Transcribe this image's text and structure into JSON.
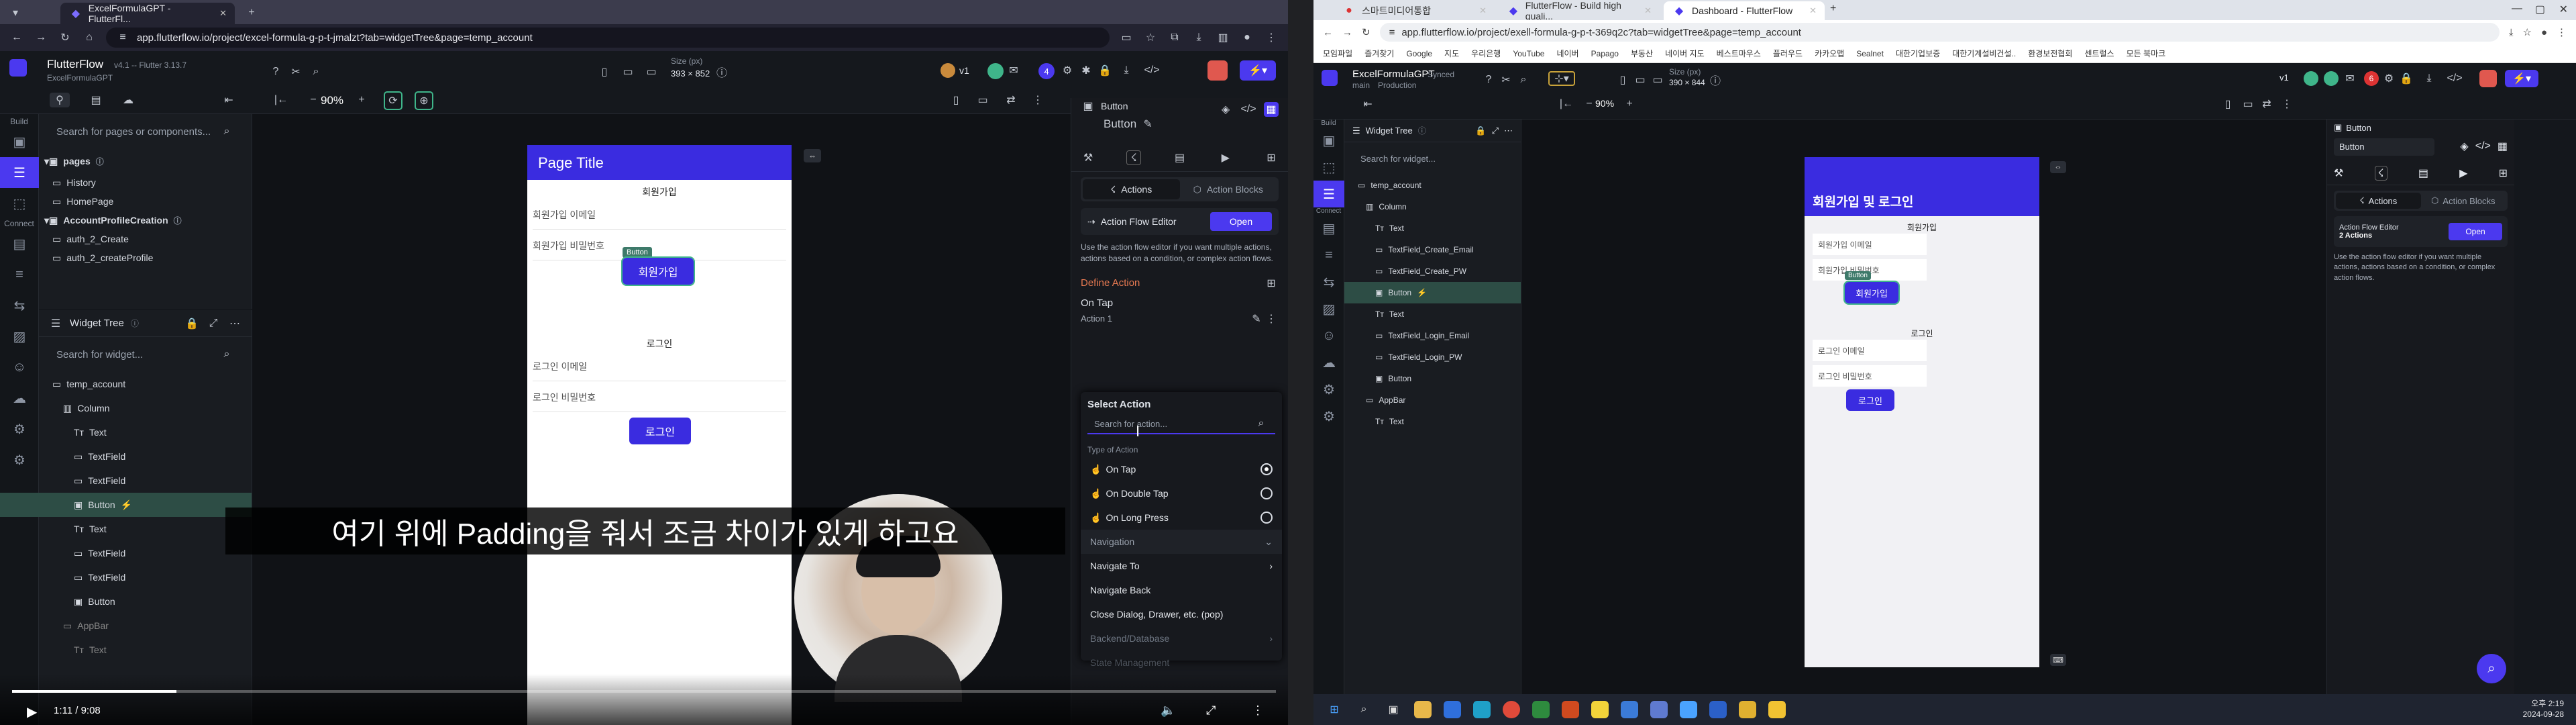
{
  "left": {
    "tabs": [
      {
        "label": "ExcelFormulaGPT - FlutterFl..."
      }
    ],
    "url": "app.flutterflow.io/project/excel-formula-g-p-t-jmalzt?tab=widgetTree&page=temp_account",
    "project": {
      "name": "FlutterFlow",
      "version": "v4.1 -- Flutter 3.13.7",
      "sub": "ExcelFormulaGPT"
    },
    "zoom": "90%",
    "size": {
      "label": "Size (px)",
      "value": "393 × 852"
    },
    "version_badge": "v1",
    "count_badge": "4",
    "rail": {
      "build": "Build",
      "connect": "Connect"
    },
    "pages": {
      "search": "Search for pages or components...",
      "header": "pages",
      "items": [
        "History",
        "HomePage"
      ],
      "folder": "AccountProfileCreation",
      "sub_items": [
        "auth_2_Create",
        "auth_2_createProfile"
      ]
    },
    "widget_tree": {
      "title": "Widget Tree",
      "search": "Search for widget...",
      "root": "temp_account",
      "items": [
        "Column",
        "Text",
        "TextField",
        "TextField",
        "Button",
        "Text",
        "TextField",
        "TextField",
        "Button",
        "AppBar",
        "Text"
      ]
    },
    "canvas": {
      "appbar_title": "Page Title",
      "signup_heading": "회원가입",
      "signup_email": "회원가입 이메일",
      "signup_password": "회원가입 비밀번호",
      "button_tag": "Button",
      "signup_button": "회원가입",
      "login_heading": "로그인",
      "login_email": "로그인 이메일",
      "login_password": "로그인 비밀번호",
      "login_button": "로그인"
    },
    "props": {
      "title": "Button",
      "subtitle": "Button",
      "tabs": [
        "Actions",
        "Action Blocks"
      ],
      "flow_editor": "Action Flow Editor",
      "open": "Open",
      "flow_desc": "Use the action flow editor if you want multiple actions, actions based on a condition, or complex action flows.",
      "define": "Define Action",
      "on_tap": "On Tap",
      "action1": "Action 1",
      "select_action": "Select Action",
      "search_action": "Search for action...",
      "type_label": "Type of Action",
      "types": [
        "On Tap",
        "On Double Tap",
        "On Long Press"
      ],
      "nav_section": "Navigation",
      "nav_items": [
        "Navigate To",
        "Navigate Back",
        "Close Dialog, Drawer, etc. (pop)"
      ],
      "backend_section": "Backend/Database",
      "state_section": "State Management"
    },
    "subtitle": "여기 위에 Padding을 줘서 조금 차이가 있게 하고요",
    "video": {
      "time": "1:11 / 9:08",
      "progress": 0.13
    }
  },
  "right": {
    "tabs": [
      {
        "label": "스마트미디어통합"
      },
      {
        "label": "FlutterFlow - Build high quali..."
      },
      {
        "label": "Dashboard - FlutterFlow"
      }
    ],
    "url": "app.flutterflow.io/project/exell-formula-g-p-t-369q2c?tab=widgetTree&page=temp_account",
    "bookmarks": [
      "모임파일",
      "즐겨찾기",
      "Google",
      "지도",
      "우리은행",
      "YouTube",
      "네이버",
      "Papago",
      "부동산",
      "네이버 지도",
      "베스트마우스",
      "플러우드",
      "카카오맵",
      "Sealnet",
      "대한기업보증",
      "대한기계설비건설..",
      "환경보전협회",
      "센트럴스",
      "모든 북마크"
    ],
    "project": {
      "name": "ExcelFormulaGPT",
      "tag": "Synced",
      "branch": "main",
      "env": "Production"
    },
    "zoom": "90%",
    "size": {
      "label": "Size (px)",
      "value": "390 × 844"
    },
    "version_badge": "v1",
    "count_badge": "6",
    "rail": {
      "build": "Build",
      "connect": "Connect"
    },
    "widget_tree": {
      "title": "Widget Tree",
      "search": "Search for widget...",
      "root": "temp_account",
      "items": [
        "Column",
        "Text",
        "TextField_Create_Email",
        "TextField_Create_PW",
        "Button",
        "Text",
        "TextField_Login_Email",
        "TextField_Login_PW",
        "Button",
        "AppBar",
        "Text"
      ]
    },
    "canvas": {
      "appbar_title": "회원가입 및 로그인",
      "signup_heading": "회원가입",
      "signup_email": "회원가입 이메일",
      "signup_password": "회원가입 비밀번호",
      "button_tag": "Button",
      "signup_button": "회원가입",
      "login_heading": "로그인",
      "login_email": "로그인 이메일",
      "login_password": "로그인 비밀번호",
      "login_button": "로그인"
    },
    "props": {
      "title": "Button",
      "name_value": "Button",
      "tabs": [
        "Actions",
        "Action Blocks"
      ],
      "flow_editor": "Action Flow Editor",
      "flow_count": "2 Actions",
      "open": "Open",
      "flow_desc": "Use the action flow editor if you want multiple actions, actions based on a condition, or complex action flows."
    },
    "clock": {
      "time": "오후 2:19",
      "date": "2024-09-28"
    }
  },
  "colors": {
    "accent": "#4B39EF",
    "selected_row": "#2D4D45",
    "phone_bar": "#3A2CE0"
  }
}
